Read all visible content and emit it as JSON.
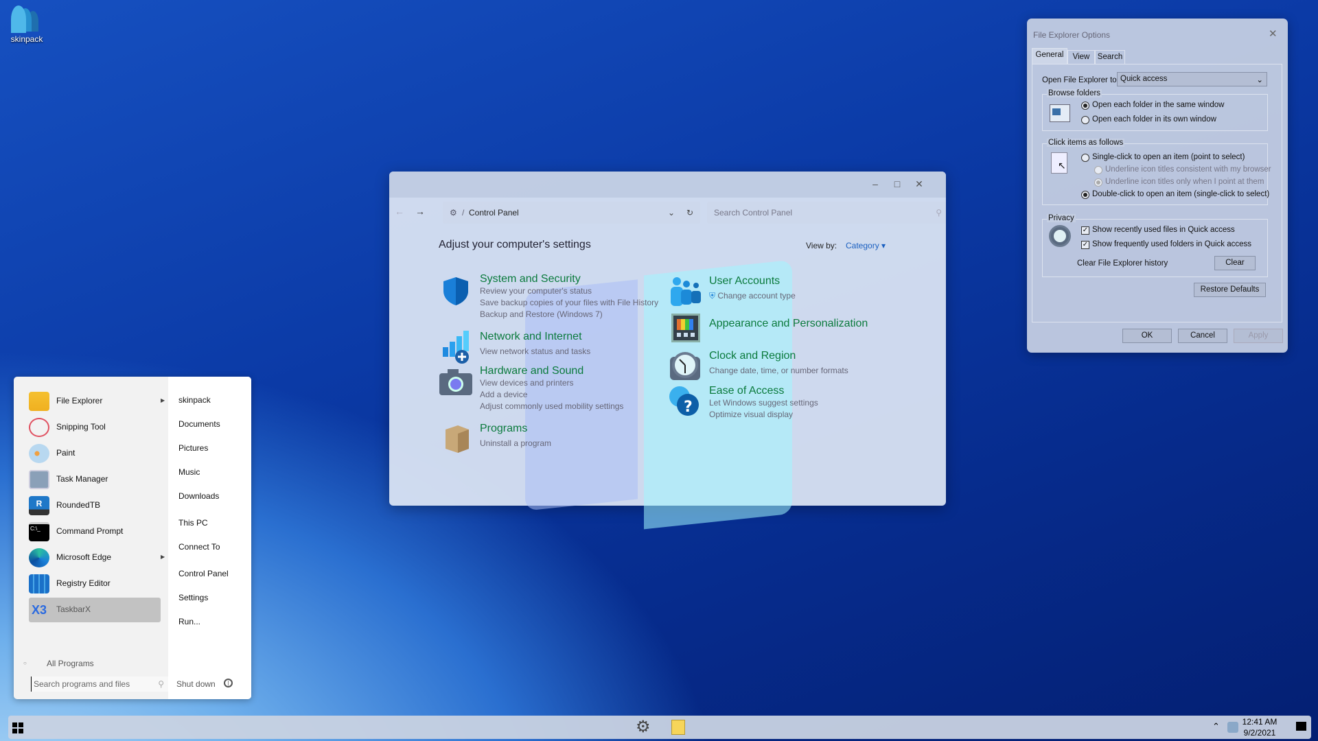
{
  "desktop": {
    "icons": [
      {
        "label": "skinpack",
        "icon": "users-icon"
      }
    ]
  },
  "control_panel": {
    "address": "Control Panel",
    "search_placeholder": "Search Control Panel",
    "heading": "Adjust your computer's settings",
    "view_by_label": "View by:",
    "view_by_value": "Category",
    "categories_left": [
      {
        "title": "System and Security",
        "icon": "shield-icon",
        "links": [
          "Review your computer's status",
          "Save backup copies of your files with File History",
          "Backup and Restore (Windows 7)"
        ]
      },
      {
        "title": "Network and Internet",
        "icon": "network-icon",
        "links": [
          "View network status and tasks"
        ]
      },
      {
        "title": "Hardware and Sound",
        "icon": "camera-icon",
        "links": [
          "View devices and printers",
          "Add a device",
          "Adjust commonly used mobility settings"
        ]
      },
      {
        "title": "Programs",
        "icon": "box-icon",
        "links": [
          "Uninstall a program"
        ]
      }
    ],
    "categories_right": [
      {
        "title": "User Accounts",
        "icon": "users-icon",
        "links": [
          "Change account type"
        ]
      },
      {
        "title": "Appearance and Personalization",
        "icon": "palette-icon",
        "links": []
      },
      {
        "title": "Clock and Region",
        "icon": "clock-icon",
        "links": [
          "Change date, time, or number formats"
        ]
      },
      {
        "title": "Ease of Access",
        "icon": "help-icon",
        "links": [
          "Let Windows suggest settings",
          "Optimize visual display"
        ]
      }
    ],
    "title_color": "#0a7a3c"
  },
  "dialog": {
    "title": "File Explorer Options",
    "tabs": [
      "General",
      "View",
      "Search"
    ],
    "active_tab": "General",
    "open_to_label": "Open File Explorer to:",
    "open_to_value": "Quick access",
    "browse_legend": "Browse folders",
    "browse_options": [
      {
        "label": "Open each folder in the same window",
        "checked": true
      },
      {
        "label": "Open each folder in its own window",
        "checked": false
      }
    ],
    "click_legend": "Click items as follows",
    "click_options": [
      {
        "label": "Single-click to open an item (point to select)",
        "checked": false
      },
      {
        "label": "Underline icon titles consistent with my browser",
        "checked": false,
        "disabled": true
      },
      {
        "label": "Underline icon titles only when I point at them",
        "checked": true,
        "disabled": true
      },
      {
        "label": "Double-click to open an item (single-click to select)",
        "checked": true
      }
    ],
    "privacy_legend": "Privacy",
    "privacy_options": [
      {
        "label": "Show recently used files in Quick access",
        "checked": true
      },
      {
        "label": "Show frequently used folders in Quick access",
        "checked": true
      }
    ],
    "clear_label": "Clear File Explorer history",
    "clear_button": "Clear",
    "restore_button": "Restore Defaults",
    "ok": "OK",
    "cancel": "Cancel",
    "apply": "Apply"
  },
  "start_menu": {
    "programs": [
      {
        "label": "File Explorer",
        "submenu": true
      },
      {
        "label": "Snipping Tool"
      },
      {
        "label": "Paint"
      },
      {
        "label": "Task Manager"
      },
      {
        "label": "RoundedTB"
      },
      {
        "label": "Command Prompt"
      },
      {
        "label": "Microsoft Edge",
        "submenu": true
      },
      {
        "label": "Registry Editor"
      },
      {
        "label": "TaskbarX",
        "highlighted": true
      }
    ],
    "places": [
      "skinpack",
      "Documents",
      "Pictures",
      "Music",
      "Downloads",
      "This PC",
      "Connect To",
      "Control Panel",
      "Settings",
      "Run..."
    ],
    "all_programs": "All Programs",
    "search_placeholder": "Search programs and files",
    "shutdown": "Shut down"
  },
  "taskbar": {
    "time": "12:41 AM",
    "date": "9/2/2021"
  }
}
